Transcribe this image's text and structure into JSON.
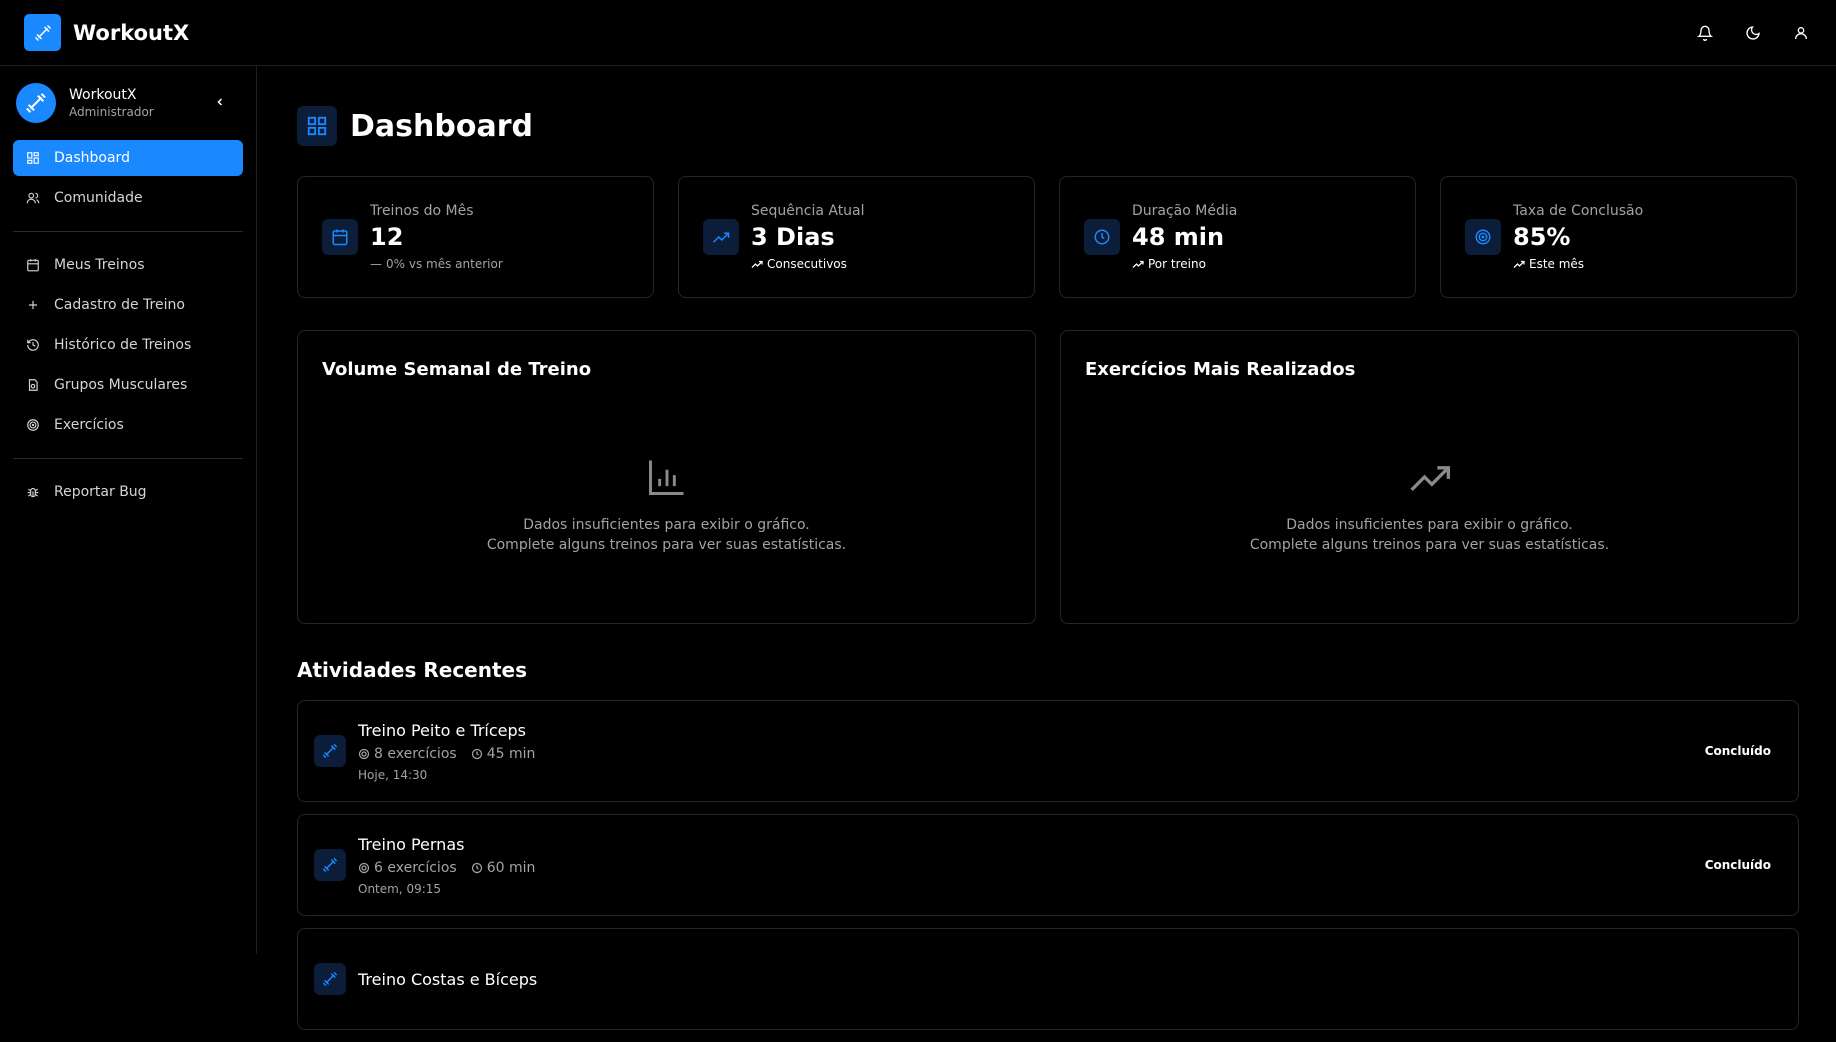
{
  "app": {
    "title": "WorkoutX",
    "accent": "#1a88ff"
  },
  "topbar": {
    "icons": [
      "bell-icon",
      "moon-icon",
      "user-icon"
    ]
  },
  "sidebar": {
    "profile": {
      "name": "WorkoutX",
      "role": "Administrador"
    },
    "group1": [
      {
        "label": "Dashboard",
        "icon": "grid-icon",
        "active": true
      },
      {
        "label": "Comunidade",
        "icon": "users-icon"
      }
    ],
    "group2": [
      {
        "label": "Meus Treinos",
        "icon": "calendar-icon"
      },
      {
        "label": "Cadastro de Treino",
        "icon": "plus-icon"
      },
      {
        "label": "Histórico de Treinos",
        "icon": "history-icon"
      },
      {
        "label": "Grupos Musculares",
        "icon": "muscle-icon"
      },
      {
        "label": "Exercícios",
        "icon": "target-icon"
      }
    ],
    "group3": [
      {
        "label": "Reportar Bug",
        "icon": "bug-icon"
      }
    ]
  },
  "page": {
    "title": "Dashboard"
  },
  "stats": [
    {
      "label": "Treinos do Mês",
      "value": "12",
      "note": "0% vs mês anterior",
      "icon": "calendar-icon"
    },
    {
      "label": "Sequência Atual",
      "value": "3 Dias",
      "note": "Consecutivos",
      "icon": "trending-up-icon"
    },
    {
      "label": "Duração Média",
      "value": "48 min",
      "note": "Por treino",
      "icon": "clock-icon"
    },
    {
      "label": "Taxa de Conclusão",
      "value": "85%",
      "note": "Este mês",
      "icon": "target-icon"
    }
  ],
  "charts": [
    {
      "title": "Volume Semanal de Treino",
      "msg1": "Dados insuficientes para exibir o gráfico.",
      "msg2": "Complete alguns treinos para ver suas estatísticas.",
      "icon": "bar-chart-icon"
    },
    {
      "title": "Exercícios Mais Realizados",
      "msg1": "Dados insuficientes para exibir o gráfico.",
      "msg2": "Complete alguns treinos para ver suas estatísticas.",
      "icon": "trending-up-icon"
    }
  ],
  "recent": {
    "title": "Atividades Recentes",
    "items": [
      {
        "title": "Treino Peito e Tríceps",
        "exercises": "8 exercícios",
        "duration": "45 min",
        "time": "Hoje, 14:30",
        "status": "Concluído"
      },
      {
        "title": "Treino Pernas",
        "exercises": "6 exercícios",
        "duration": "60 min",
        "time": "Ontem, 09:15",
        "status": "Concluído"
      },
      {
        "title": "Treino Costas e Bíceps",
        "exercises": "",
        "duration": "",
        "time": "",
        "status": ""
      }
    ]
  }
}
